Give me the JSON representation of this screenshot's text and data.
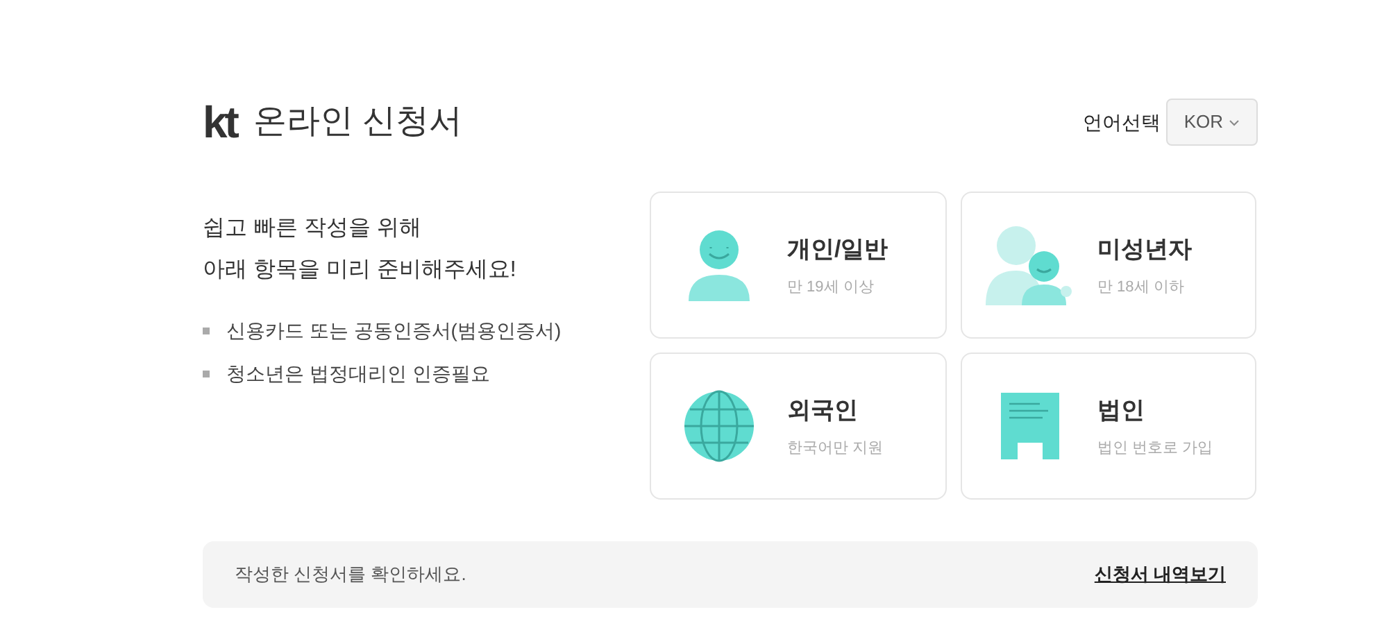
{
  "header": {
    "logo": "kt",
    "title": "온라인 신청서",
    "language_label": "언어선택",
    "language": "KOR"
  },
  "intro": {
    "lines": [
      "쉽고 빠른 작성을 위해",
      "아래 항목을 미리 준비해주세요!"
    ],
    "bullets": [
      "신용카드 또는 공동인증서(범용인증서)",
      "청소년은 법정대리인 인증필요"
    ]
  },
  "cards": [
    {
      "kind": "person",
      "title": "개인/일반",
      "subtitle": "만 19세 이상"
    },
    {
      "kind": "minor",
      "title": "미성년자",
      "subtitle": "만 18세 이하"
    },
    {
      "kind": "globe",
      "title": "외국인",
      "subtitle": "한국어만 지원"
    },
    {
      "kind": "building",
      "title": "법인",
      "subtitle": "법인 번호로 가입"
    }
  ],
  "footer": {
    "text": "작성한 신청서를 확인하세요.",
    "link": "신청서 내역보기"
  }
}
